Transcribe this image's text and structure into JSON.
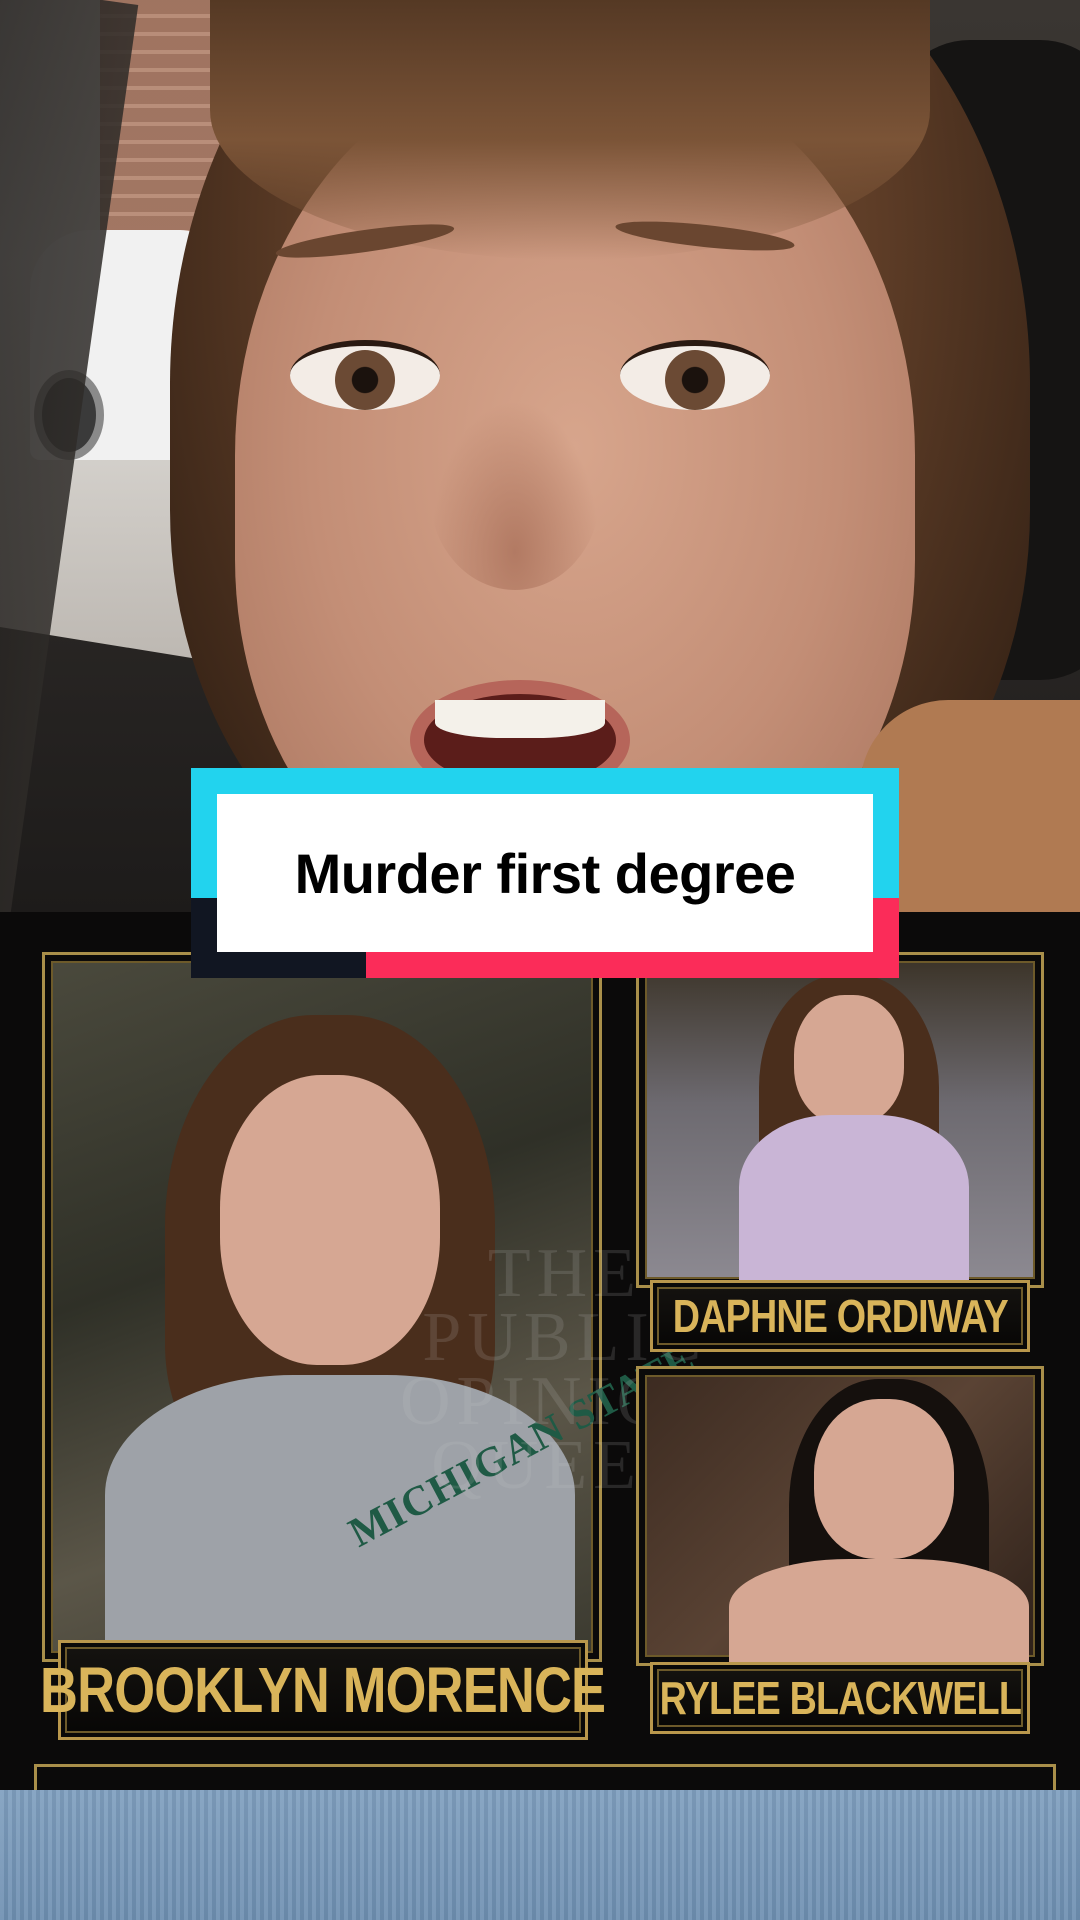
{
  "caption": {
    "text": "Murder first degree",
    "colors": {
      "cyan": "#22d3ee",
      "red": "#fb2c59",
      "dark": "#111622",
      "box": "#ffffff"
    }
  },
  "poster": {
    "main_name": "BROOKLYN MORENCE",
    "top_name": "DAPHNE ORDIWAY",
    "bottom_name": "RYLEE BLACKWELL",
    "hoodie_text": "MICHIGAN STATE",
    "watermark_lines": [
      "THE",
      "PUBLIC",
      "OPINION",
      "QUEEN"
    ],
    "nameplate_color": "#d9b45a",
    "frame_color": "#a98f4a"
  }
}
